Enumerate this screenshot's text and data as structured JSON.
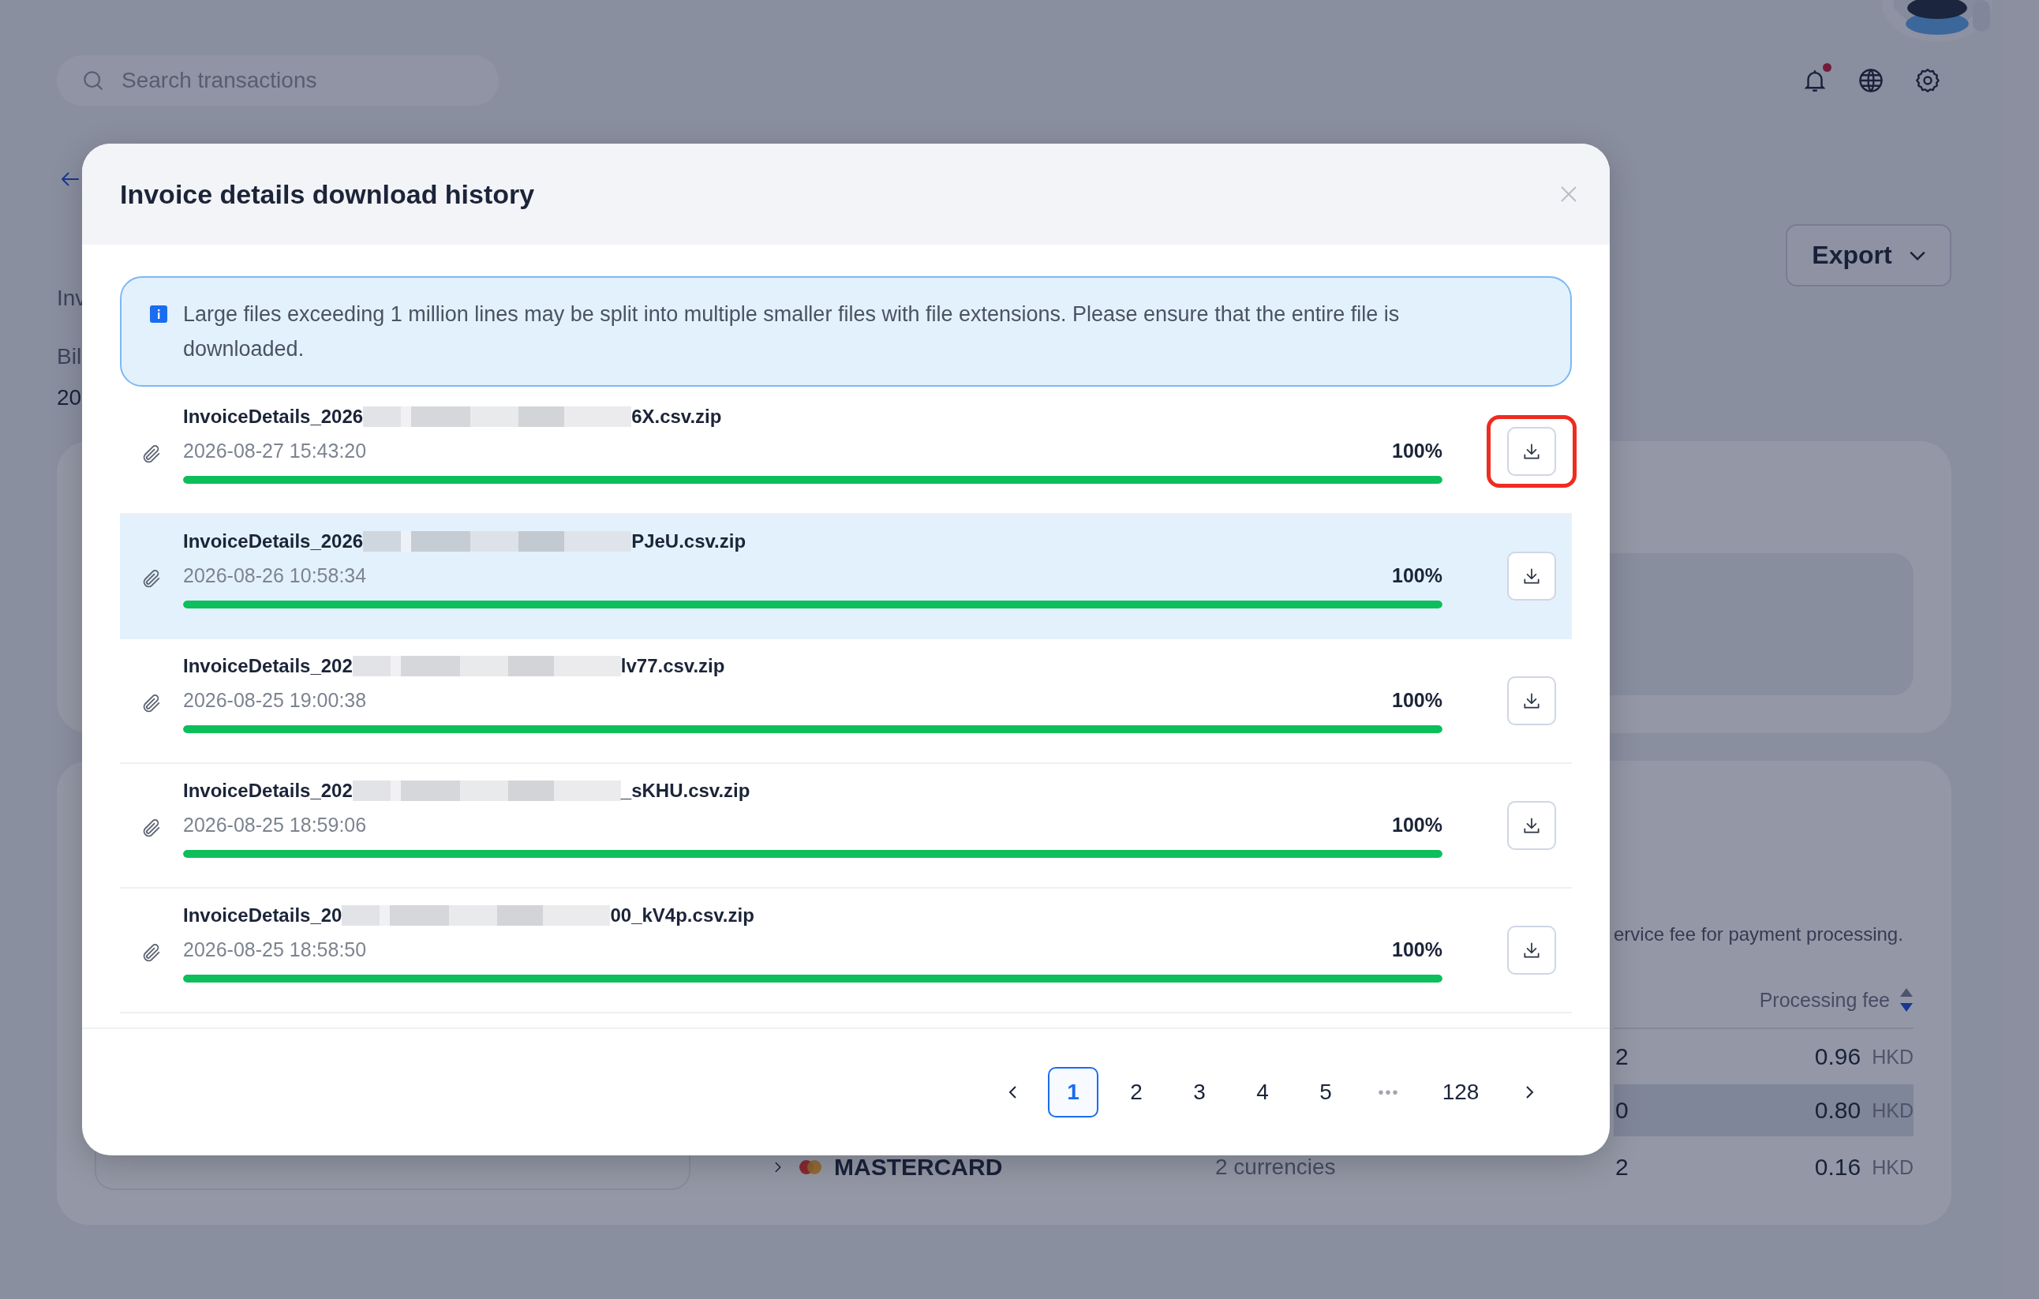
{
  "background_page": {
    "search": {
      "placeholder": "Search transactions"
    },
    "notification_unread": true,
    "label_fragments": [
      "Inv",
      "Bil",
      "20"
    ],
    "export_button": "Export",
    "fee_description": "ervice fee for payment processing.",
    "fee_column": "Processing fee",
    "sorted_descending": true,
    "fee_rows": [
      {
        "count": "2",
        "fee": "0.96",
        "currency": "HKD",
        "shaded": false
      },
      {
        "count": "0",
        "fee": "0.80",
        "currency": "HKD",
        "shaded": true
      },
      {
        "network": "MASTERCARD",
        "currencies": "2 currencies",
        "count": "2",
        "fee": "0.16",
        "currency": "HKD",
        "shaded": false
      }
    ]
  },
  "modal": {
    "title": "Invoice details download history",
    "notice": "Large files exceeding 1 million lines may be split into multiple smaller files with file extensions. Please ensure that the entire file is downloaded.",
    "files": [
      {
        "name_start": "InvoiceDetails_2026",
        "name_end": "6X.csv.zip",
        "time": "2026-08-27 15:43:20",
        "percent": "100%",
        "level": 1,
        "hovered": false,
        "highlighted": true
      },
      {
        "name_start": "InvoiceDetails_2026",
        "name_end": "PJeU.csv.zip",
        "time": "2026-08-26 10:58:34",
        "percent": "100%",
        "level": 1,
        "hovered": true,
        "highlighted": false
      },
      {
        "name_start": "InvoiceDetails_202",
        "name_end": "lv77.csv.zip",
        "time": "2026-08-25 19:00:38",
        "percent": "100%",
        "level": 1,
        "hovered": false,
        "highlighted": false
      },
      {
        "name_start": "InvoiceDetails_202",
        "name_end": "_sKHU.csv.zip",
        "time": "2026-08-25 18:59:06",
        "percent": "100%",
        "level": 1,
        "hovered": false,
        "highlighted": false
      },
      {
        "name_start": "InvoiceDetails_20",
        "name_end": "00_kV4p.csv.zip",
        "time": "2026-08-25 18:58:50",
        "percent": "100%",
        "level": 1,
        "hovered": false,
        "highlighted": false
      }
    ],
    "pagination": {
      "pages": [
        {
          "label": "1",
          "selected": true
        },
        {
          "label": "2",
          "selected": false
        },
        {
          "label": "3",
          "selected": false
        },
        {
          "label": "4",
          "selected": false
        },
        {
          "label": "5",
          "selected": false
        },
        {
          "label": "•••",
          "kind": "ellipsis",
          "selected": false
        },
        {
          "label": "128",
          "selected": false
        }
      ]
    }
  }
}
